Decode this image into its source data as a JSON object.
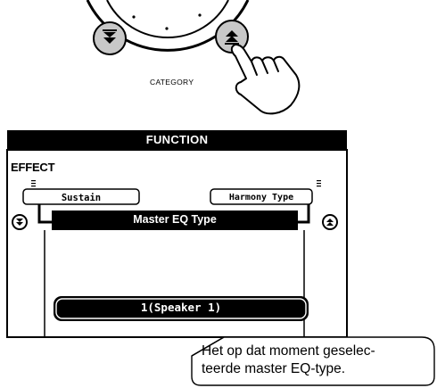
{
  "panel": {
    "category_label": "CATEGORY",
    "function_title": "FUNCTION",
    "effect_label": "EFFECT",
    "left_item": "Sustain",
    "right_item": "Harmony Type",
    "selected_title": "Master EQ Type",
    "selected_value": "1(Speaker 1)"
  },
  "callout": {
    "line1": "Het op dat moment geselec-",
    "line2": "teerde master EQ-type."
  },
  "icons": {
    "left_button": "double-chevron-down-icon",
    "right_button": "double-chevron-up-icon",
    "pointer": "pointing-hand-icon"
  }
}
